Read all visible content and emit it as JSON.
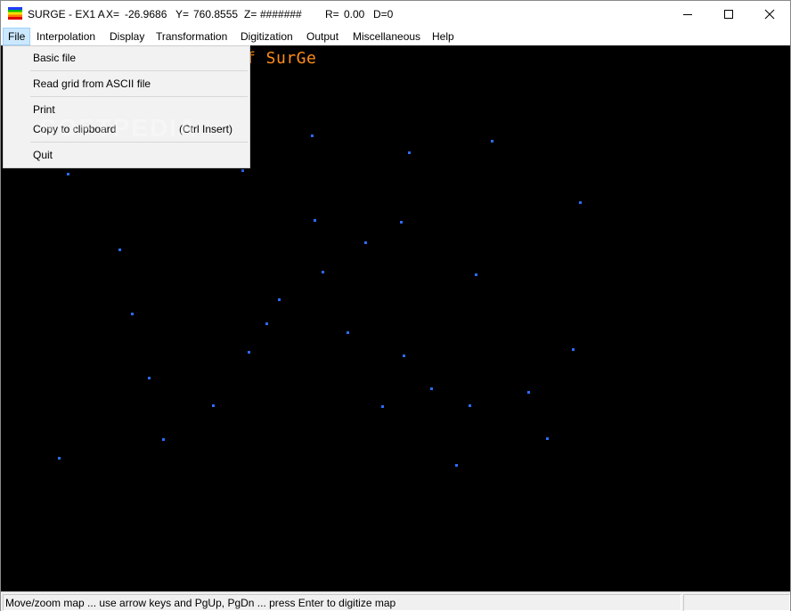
{
  "titlebar": {
    "app_name": "SURGE - EX1 A",
    "x_label": "X=",
    "x_value": "-26.9686",
    "y_label": "Y=",
    "y_value": "760.8555",
    "z_label": "Z=",
    "z_value": "#######",
    "r_label": "R=",
    "r_value": "0.00",
    "d_text": "D=0",
    "icon": "surge-app-icon"
  },
  "window_controls": {
    "minimize_icon": "minimize-icon",
    "maximize_icon": "maximize-icon",
    "close_icon": "close-icon"
  },
  "menubar": {
    "items": [
      {
        "label": "File",
        "active": true
      },
      {
        "label": "Interpolation"
      },
      {
        "label": "Display"
      },
      {
        "label": "Transformation"
      },
      {
        "label": "Digitization"
      },
      {
        "label": "Output"
      },
      {
        "label": "Miscellaneous"
      },
      {
        "label": "Help"
      }
    ]
  },
  "file_menu": {
    "items": [
      {
        "label": "Basic file"
      },
      {
        "label": "Read grid from ASCII file"
      },
      {
        "label": "Print"
      },
      {
        "label": "Copy to clipboard",
        "shortcut": "(Ctrl Insert)"
      },
      {
        "label": "Quit"
      }
    ]
  },
  "watermark": "SOFTPEDIA",
  "canvas": {
    "title": "f SurGe",
    "title_color": "#ff8c1a",
    "background": "#000000",
    "point_color": "#2a6cff"
  },
  "statusbar": {
    "message": "Move/zoom map ... use arrow keys and PgUp, PgDn ... press Enter to digitize map"
  }
}
